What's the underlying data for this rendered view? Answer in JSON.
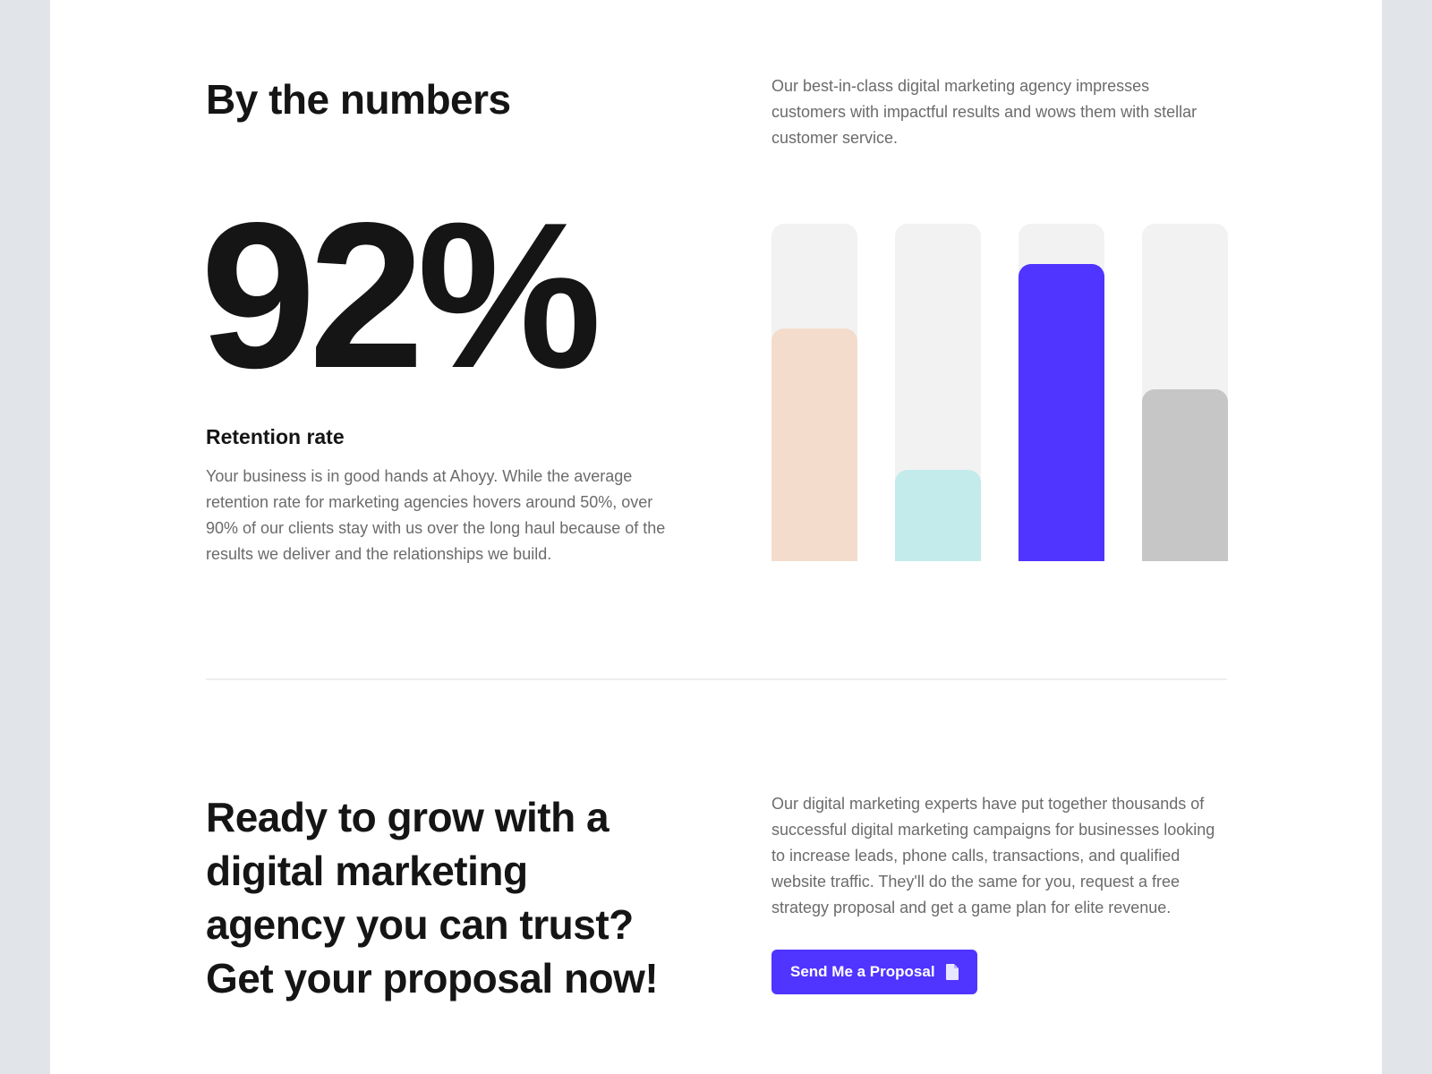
{
  "section_numbers": {
    "title": "By the numbers",
    "intro": "Our best-in-class digital marketing agency impresses customers with impactful results and wows them with stellar customer service.",
    "stat_value": "92%",
    "stat_label": "Retention rate",
    "stat_description": "Your business is in good hands at Ahoyy. While the average retention rate for marketing agencies hovers around 50%, over 90% of our clients stay with us over the long haul because of the results we deliver and the relationships we build."
  },
  "chart_data": {
    "type": "bar",
    "max": 1,
    "values": [
      0.69,
      0.27,
      0.88,
      0.51
    ],
    "colors": [
      "#f4dccd",
      "#c3ebeb",
      "#5034ff",
      "#c6c6c6"
    ],
    "track_color": "#f2f2f2"
  },
  "cta": {
    "heading": "Ready to grow with a digital marketing agency you can trust? Get your proposal now!",
    "description": "Our digital marketing experts have put together thousands of successful digital marketing campaigns for businesses looking to increase leads, phone calls, transactions, and qualified website traffic. They'll do the same for you, request a free strategy proposal and get a game plan for elite revenue.",
    "button_label": "Send Me a Proposal",
    "button_icon": "document-icon",
    "accent_color": "#5034ff"
  }
}
